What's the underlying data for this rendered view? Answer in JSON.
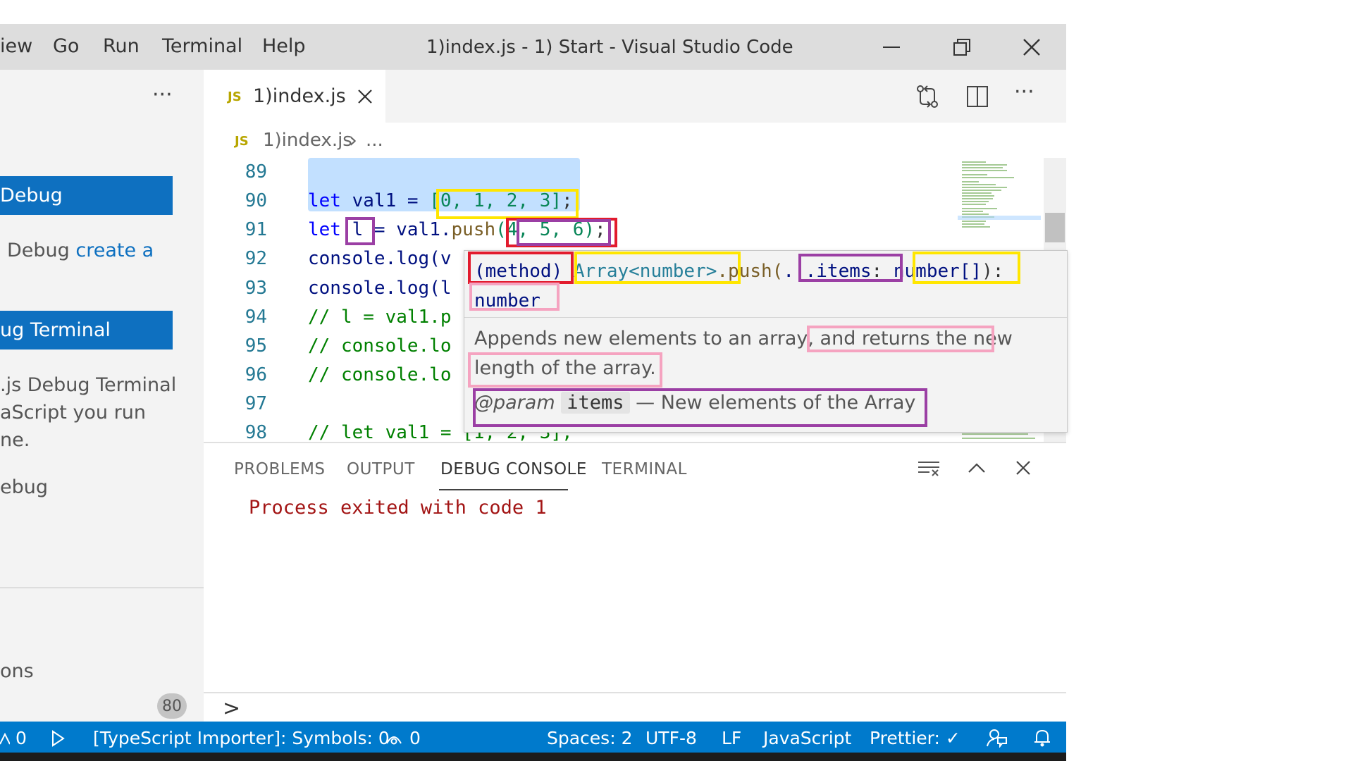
{
  "window": {
    "menu": [
      "iew",
      "Go",
      "Run",
      "Terminal",
      "Help"
    ],
    "title": "1)index.js - 1) Start - Visual Studio Code"
  },
  "sidebar": {
    "more": "···",
    "debug_button": "Debug",
    "debug_text_prefix": "Debug ",
    "debug_text_link": "create a",
    "terminal_button": "ug Terminal",
    "lines": [
      ".js Debug Terminal",
      "aScript you run",
      "ne.",
      "ebug"
    ],
    "bottom_lines": [
      "ons"
    ],
    "badge": "80"
  },
  "tab": {
    "icon": "JS",
    "label": "1)index.js"
  },
  "breadcrumb": {
    "icon": "JS",
    "file": "1)index.js",
    "sep": "›",
    "rest": "..."
  },
  "editor": {
    "line_numbers": [
      "89",
      "90",
      "91",
      "92",
      "93",
      "94",
      "95",
      "96",
      "97",
      "98"
    ],
    "lines": {
      "l90_kw": "let",
      "l90_var": " val1 = ",
      "l90_arr": "[0, 1, 2, 3]",
      "l90_end": ";",
      "l91_kw": "let",
      "l91_var": " l",
      "l91_mid": " = val1.",
      "l91_fn": "push",
      "l91_args": "(4, 5, 6)",
      "l91_end": ";",
      "l92": "console.log(v",
      "l93": "console.log(l",
      "l94": "// l = val1.p",
      "l95": "// console.lo",
      "l96": "// console.lo",
      "l98": "// let val1 = [1, 2, 3];"
    }
  },
  "hover": {
    "method": "(method)",
    "type": "Array<number>",
    "dot_push": ".push(",
    "param": "...items",
    "colon": ":",
    "param_type": "number[]",
    "close": "):",
    "return_type": "number",
    "doc_line1a": "Appends new elements to an array,",
    "doc_line1b": " and returns the new",
    "doc_line2": "length of the array.",
    "param_tag": "@param",
    "param_name": "items",
    "param_desc": "— New elements of the Array"
  },
  "panel": {
    "tabs": [
      "PROBLEMS",
      "OUTPUT",
      "DEBUG CONSOLE",
      "TERMINAL"
    ],
    "active_tab": "DEBUG CONSOLE",
    "output": "Process exited with code 1",
    "prompt": ">"
  },
  "statusbar": {
    "warnings": "0",
    "importer": "[TypeScript Importer]: Symbols: 0",
    "watch": "0",
    "spaces": "Spaces: 2",
    "encoding": "UTF-8",
    "eol": "LF",
    "language": "JavaScript",
    "prettier": "Prettier: ✓"
  },
  "colors": {
    "accent": "#007acc",
    "sidebar_button": "#0e70c0",
    "annotation_yellow": "#ffe600",
    "annotation_red": "#e21b2d",
    "annotation_purple": "#9b3fa4",
    "annotation_pink": "#f5a3c0"
  }
}
